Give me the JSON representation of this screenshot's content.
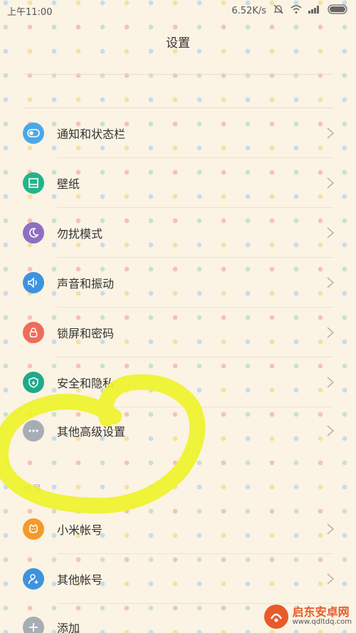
{
  "status_bar": {
    "time": "上午11:00",
    "net_speed": "6.52K/s",
    "icons": [
      "mute-bell-icon",
      "wifi-icon",
      "signal-icon",
      "battery-icon"
    ]
  },
  "header": {
    "title": "设置"
  },
  "settings": {
    "items": [
      {
        "label": "通知和状态栏",
        "icon": "toggle-icon",
        "color": "#4aa8e8"
      },
      {
        "label": "壁纸",
        "icon": "wallpaper-icon",
        "color": "#22b58a"
      },
      {
        "label": "勿扰模式",
        "icon": "moon-icon",
        "color": "#8e6fc2"
      },
      {
        "label": "声音和振动",
        "icon": "speaker-icon",
        "color": "#3d93e0"
      },
      {
        "label": "锁屏和密码",
        "icon": "lock-icon",
        "color": "#ef6b5b"
      },
      {
        "label": "安全和隐私",
        "icon": "shield-icon",
        "color": "#1fa98a"
      },
      {
        "label": "其他高级设置",
        "icon": "more-dots-icon",
        "color": "#a7adb4"
      }
    ]
  },
  "accounts": {
    "section_label": "帐号",
    "items": [
      {
        "label": "小米帐号",
        "icon": "mi-account-icon",
        "color": "#f39a2b"
      },
      {
        "label": "其他帐号",
        "icon": "add-person-icon",
        "color": "#3d93e0"
      },
      {
        "label": "添加",
        "icon": "plus-icon",
        "color": "#a7adb4"
      }
    ]
  },
  "watermark": {
    "title": "启东安卓网",
    "url": "www.qdltdq.com"
  }
}
